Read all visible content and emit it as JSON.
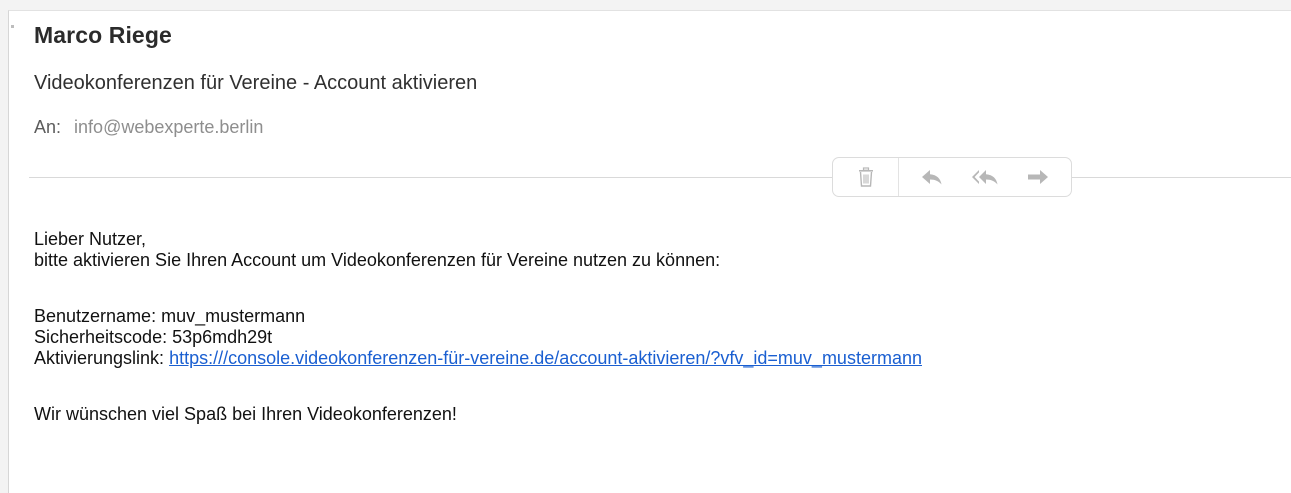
{
  "email": {
    "sender": "Marco Riege",
    "subject": "Videokonferenzen für Vereine - Account aktivieren",
    "to_label": "An:",
    "to_address": "info@webexperte.berlin"
  },
  "toolbar": {
    "icons": [
      "trash-icon",
      "reply-icon",
      "reply-all-icon",
      "forward-icon"
    ]
  },
  "body": {
    "greeting": "Lieber Nutzer,",
    "intro": "bitte aktivieren Sie Ihren Account um Videokonferenzen für Vereine nutzen zu können:",
    "username_label": "Benutzername:",
    "username_value": "muv_mustermann",
    "code_label": "Sicherheitscode:",
    "code_value": "53p6mdh29t",
    "link_label": "Aktivierungslink:",
    "link_url": "https:///console.videokonferenzen-für-vereine.de/account-aktivieren/?vfv_id=muv_mustermann",
    "closing": "Wir wünschen viel Spaß bei Ihren Videokonferenzen!"
  },
  "colors": {
    "link": "#1a5fd1",
    "toolbar_icon": "#b7b7b7"
  }
}
